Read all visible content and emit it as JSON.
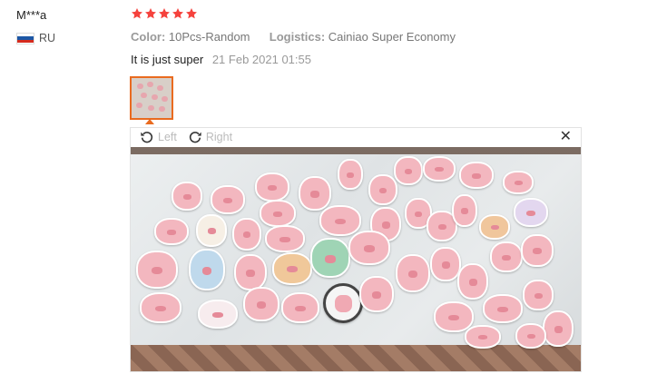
{
  "buyer": {
    "name": "M***a",
    "country": "RU"
  },
  "rating": {
    "stars": 5,
    "color": "#f5423d"
  },
  "order": {
    "color_label": "Color:",
    "color_value": "10Pcs-Random",
    "logistics_label": "Logistics:",
    "logistics_value": "Cainiao Super Economy"
  },
  "review": {
    "text": "It is just super",
    "date": "21 Feb 2021 01:55"
  },
  "viewer": {
    "rotate_left": "Left",
    "rotate_right": "Right",
    "close_glyph": "✕",
    "icons": [
      "rotate-left-icon",
      "rotate-right-icon",
      "close-icon"
    ]
  },
  "colors": {
    "accent": "#e96b1f",
    "sticker_pink": "#f3b7bf"
  }
}
